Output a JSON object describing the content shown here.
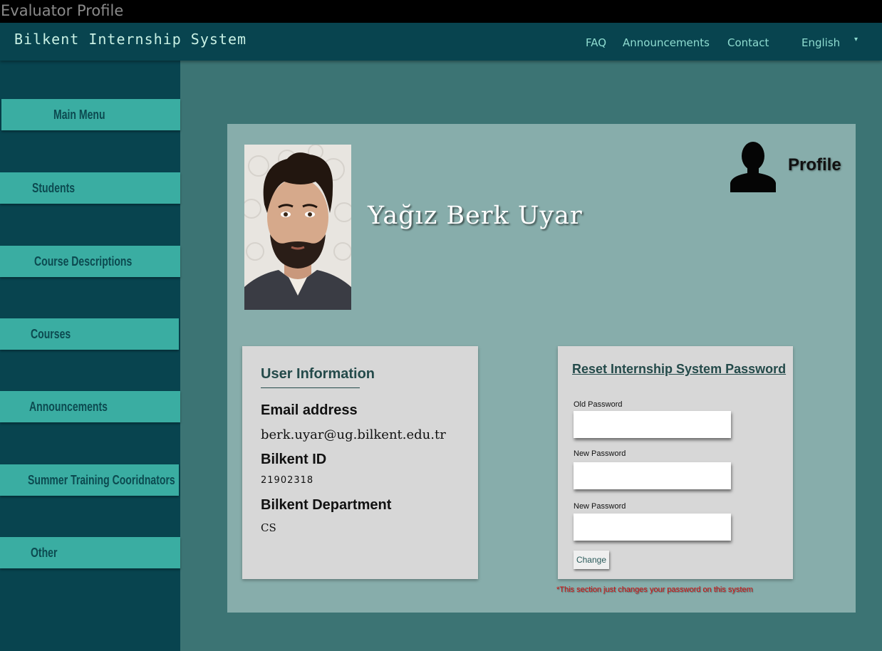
{
  "window": {
    "title": "Evaluator Profile"
  },
  "header": {
    "brand": "Bilkent Internship System",
    "nav": {
      "faq": "FAQ",
      "announcements": "Announcements",
      "contact": "Contact"
    },
    "language": "English"
  },
  "sidebar": {
    "items": [
      {
        "label": "Main Menu"
      },
      {
        "label": "Students"
      },
      {
        "label": "Course Descriptions"
      },
      {
        "label": "Courses"
      },
      {
        "label": "Announcements"
      },
      {
        "label": "Summer Training Cooridnators"
      },
      {
        "label": "Other"
      }
    ]
  },
  "profile": {
    "name": "Yağız Berk Uyar",
    "label": "Profile",
    "icon": "user-silhouette-icon"
  },
  "user_info": {
    "title": "User Information",
    "email_label": "Email address",
    "email": "berk.uyar@ug.bilkent.edu.tr",
    "id_label": "Bilkent ID",
    "id": "21902318",
    "department_label": "Bilkent Department",
    "department": "CS"
  },
  "reset": {
    "title": "Reset Internship System Password",
    "old_label": "Old Password",
    "new_label": "New Password",
    "confirm_label": "New Password",
    "old_value": "",
    "new_value": "",
    "confirm_value": "",
    "button": "Change",
    "note": "*This section just changes your password on this system"
  },
  "colors": {
    "page_bg": "#3c7474",
    "header_bg": "#08444f",
    "sidebar_button": "#3aada2",
    "card_bg": "#87adab",
    "panel_bg": "#d7d7d7",
    "note": "#d01010"
  }
}
